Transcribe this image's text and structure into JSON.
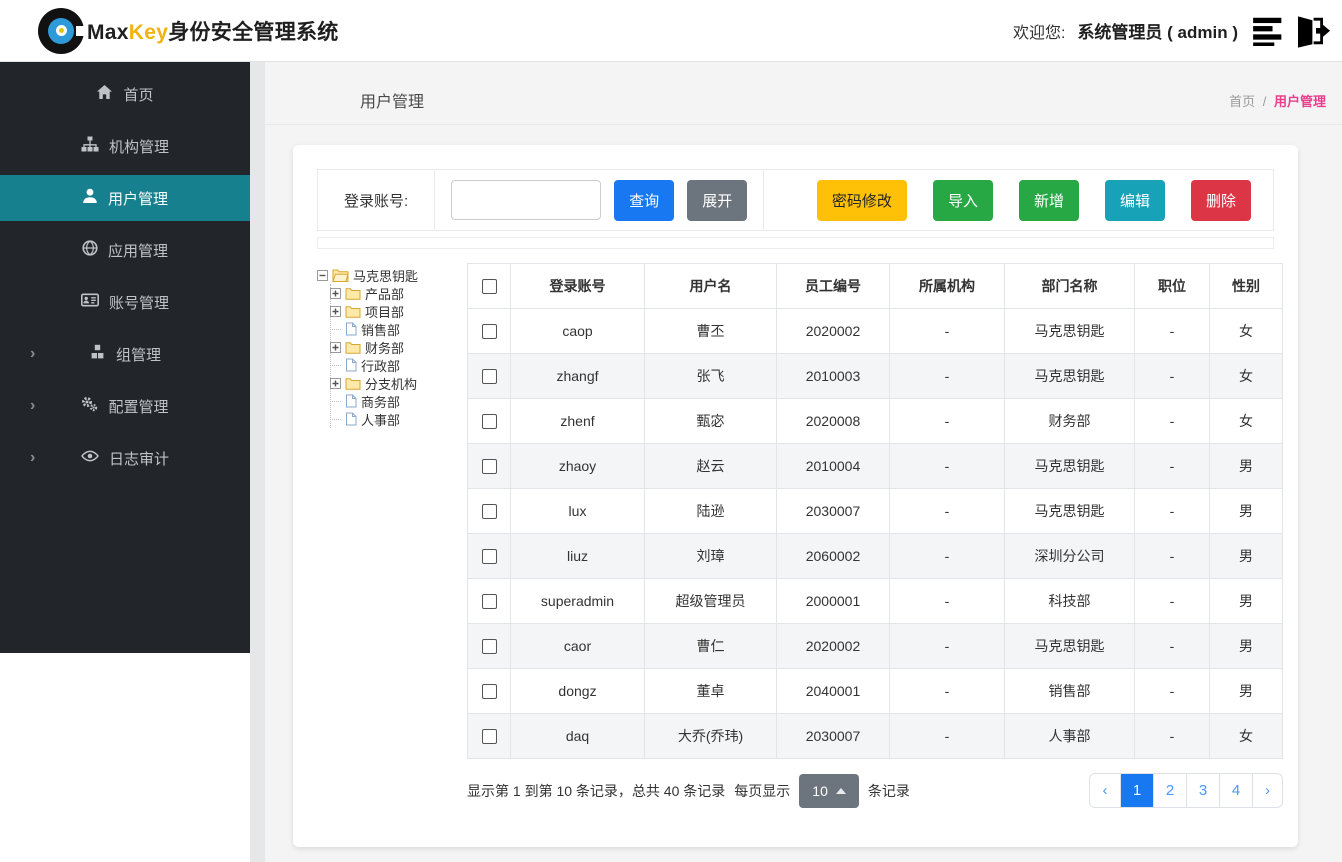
{
  "header": {
    "brand_max": "Max",
    "brand_key": "Key",
    "brand_suffix": "身份安全管理系统",
    "welcome_label": "欢迎您:",
    "user_label": "系统管理员 ( admin )"
  },
  "sidebar": {
    "chevron": "›",
    "items": [
      {
        "label": "首页",
        "icon": "home-icon",
        "active": false,
        "expandable": false
      },
      {
        "label": "机构管理",
        "icon": "sitemap-icon",
        "active": false,
        "expandable": false
      },
      {
        "label": "用户管理",
        "icon": "user-icon",
        "active": true,
        "expandable": false
      },
      {
        "label": "应用管理",
        "icon": "globe-icon",
        "active": false,
        "expandable": false
      },
      {
        "label": "账号管理",
        "icon": "id-card-icon",
        "active": false,
        "expandable": false
      },
      {
        "label": "组管理",
        "icon": "cubes-icon",
        "active": false,
        "expandable": true
      },
      {
        "label": "配置管理",
        "icon": "gears-icon",
        "active": false,
        "expandable": true
      },
      {
        "label": "日志审计",
        "icon": "eye-icon",
        "active": false,
        "expandable": true
      }
    ]
  },
  "page": {
    "title": "用户管理",
    "breadcrumb_home": "首页",
    "breadcrumb_separator": "/",
    "breadcrumb_current": "用户管理"
  },
  "toolbar": {
    "search_label": "登录账号:",
    "search_value": "",
    "search_button": "查询",
    "expand_button": "展开",
    "password_button": "密码修改",
    "import_button": "导入",
    "add_button": "新增",
    "edit_button": "编辑",
    "delete_button": "删除"
  },
  "tree": {
    "root": {
      "label": "马克思钥匙",
      "icon": "folder-open-icon",
      "state": "expanded"
    },
    "children": [
      {
        "label": "产品部",
        "icon": "folder-icon",
        "state": "collapsed"
      },
      {
        "label": "项目部",
        "icon": "folder-icon",
        "state": "collapsed"
      },
      {
        "label": "销售部",
        "icon": "file-icon",
        "state": "leaf"
      },
      {
        "label": "财务部",
        "icon": "folder-icon",
        "state": "collapsed"
      },
      {
        "label": "行政部",
        "icon": "file-icon",
        "state": "leaf"
      },
      {
        "label": "分支机构",
        "icon": "folder-icon",
        "state": "collapsed"
      },
      {
        "label": "商务部",
        "icon": "file-icon",
        "state": "leaf"
      },
      {
        "label": "人事部",
        "icon": "file-icon",
        "state": "leaf"
      }
    ]
  },
  "table": {
    "columns": [
      "登录账号",
      "用户名",
      "员工编号",
      "所属机构",
      "部门名称",
      "职位",
      "性别"
    ],
    "rows": [
      {
        "login": "caop",
        "name": "曹丕",
        "emp": "2020002",
        "org": "-",
        "dept": "马克思钥匙",
        "pos": "-",
        "gender": "女"
      },
      {
        "login": "zhangf",
        "name": "张飞",
        "emp": "2010003",
        "org": "-",
        "dept": "马克思钥匙",
        "pos": "-",
        "gender": "女"
      },
      {
        "login": "zhenf",
        "name": "甄宓",
        "emp": "2020008",
        "org": "-",
        "dept": "财务部",
        "pos": "-",
        "gender": "女"
      },
      {
        "login": "zhaoy",
        "name": "赵云",
        "emp": "2010004",
        "org": "-",
        "dept": "马克思钥匙",
        "pos": "-",
        "gender": "男"
      },
      {
        "login": "lux",
        "name": "陆逊",
        "emp": "2030007",
        "org": "-",
        "dept": "马克思钥匙",
        "pos": "-",
        "gender": "男"
      },
      {
        "login": "liuz",
        "name": "刘璋",
        "emp": "2060002",
        "org": "-",
        "dept": "深圳分公司",
        "pos": "-",
        "gender": "男"
      },
      {
        "login": "superadmin",
        "name": "超级管理员",
        "emp": "2000001",
        "org": "-",
        "dept": "科技部",
        "pos": "-",
        "gender": "男"
      },
      {
        "login": "caor",
        "name": "曹仁",
        "emp": "2020002",
        "org": "-",
        "dept": "马克思钥匙",
        "pos": "-",
        "gender": "男"
      },
      {
        "login": "dongz",
        "name": "董卓",
        "emp": "2040001",
        "org": "-",
        "dept": "销售部",
        "pos": "-",
        "gender": "男"
      },
      {
        "login": "daq",
        "name": "大乔(乔玮)",
        "emp": "2030007",
        "org": "-",
        "dept": "人事部",
        "pos": "-",
        "gender": "女"
      }
    ]
  },
  "pagination": {
    "info": "显示第 1 到第 10 条记录，总共 40 条记录",
    "per_page_prefix": "每页显示",
    "page_size": "10",
    "per_page_suffix": "条记录",
    "prev": "‹",
    "next": "›",
    "pages": [
      "1",
      "2",
      "3",
      "4"
    ],
    "active_page": "1"
  },
  "colors": {
    "primary_blue": "#1778f2",
    "sidebar_bg": "#22262a",
    "sidebar_active_teal": "#17808f",
    "breadcrumb_pink": "#e83e8c",
    "brand_gold": "#f0b40f",
    "warning_yellow": "#ffc107",
    "success_green": "#28a745",
    "info_teal": "#17a2b8",
    "danger_red": "#dc3545",
    "secondary_gray": "#6c757d"
  }
}
